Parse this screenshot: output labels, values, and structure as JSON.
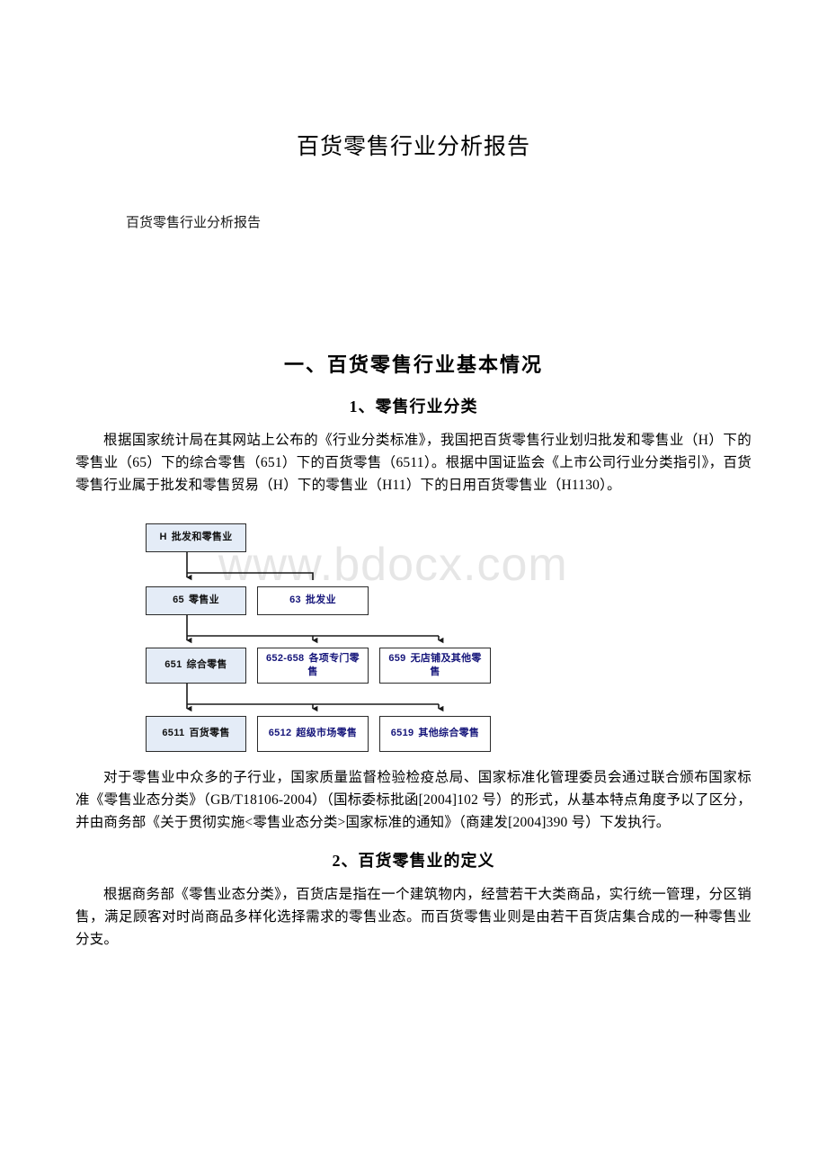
{
  "document": {
    "title": "百货零售行业分析报告",
    "subtitle": "百货零售行业分析报告",
    "watermark": "www.bdocx.com"
  },
  "sections": {
    "h1": "一、百货零售行业基本情况",
    "h2_1": "1、零售行业分类",
    "h2_2": "2、百货零售业的定义"
  },
  "paragraphs": {
    "p1": "根据国家统计局在其网站上公布的《行业分类标准》，我国把百货零售行业划归批发和零售业（H）下的零售业（65）下的综合零售（651）下的百货零售（6511）。根据中国证监会《上市公司行业分类指引》，百货零售行业属于批发和零售贸易（H）下的零售业（H11）下的日用百货零售业（H1130）。",
    "p2": "对于零售业中众多的子行业，国家质量监督检验检疫总局、国家标准化管理委员会通过联合颁布国家标准《零售业态分类》（GB/T18106-2004）（国标委标批函[2004]102 号）的形式，从基本特点角度予以了区分，并由商务部《关于贯彻实施<零售业态分类>国家标准的通知》（商建发[2004]390 号）下发执行。",
    "p3": "根据商务部《零售业态分类》，百货店是指在一个建筑物内，经营若干大类商品，实行统一管理，分区销售，满足顾客对时尚商品多样化选择需求的零售业态。而百货零售业则是由若干百货店集合成的一种零售业分支。"
  },
  "flowchart": {
    "colors": {
      "highlight_fill": "#e4ecf7",
      "box_border": "#2a2a2a",
      "code_text": "#15157a",
      "connector": "#1a1a1a"
    },
    "nodes": [
      {
        "id": "n_h",
        "code": "H",
        "label": "批发和零售业",
        "highlight": true
      },
      {
        "id": "n_65",
        "code": "65",
        "label": "零售业",
        "highlight": true
      },
      {
        "id": "n_63",
        "code": "63",
        "label": "批发业",
        "highlight": false
      },
      {
        "id": "n_651",
        "code": "651",
        "label": "综合零售",
        "highlight": true
      },
      {
        "id": "n_652",
        "code": "652-658",
        "label": "各项专门零售",
        "highlight": false
      },
      {
        "id": "n_659",
        "code": "659",
        "label": "无店铺及其他零售",
        "highlight": false
      },
      {
        "id": "n_6511",
        "code": "6511",
        "label": "百货零售",
        "highlight": true
      },
      {
        "id": "n_6512",
        "code": "6512",
        "label": "超级市场零售",
        "highlight": false
      },
      {
        "id": "n_6519",
        "code": "6519",
        "label": "其他综合零售",
        "highlight": false
      }
    ]
  }
}
